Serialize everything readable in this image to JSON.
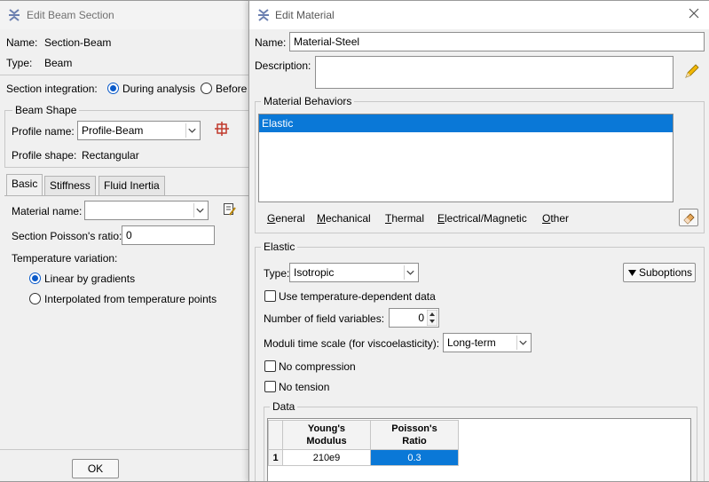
{
  "beam_dialog": {
    "title": "Edit Beam Section",
    "name_label": "Name:",
    "name_value": "Section-Beam",
    "type_label": "Type:",
    "type_value": "Beam",
    "section_integration_label": "Section integration:",
    "integration_options": [
      "During analysis",
      "Before"
    ],
    "beam_shape_title": "Beam Shape",
    "profile_name_label": "Profile name:",
    "profile_name_value": "Profile-Beam",
    "profile_shape_label": "Profile shape:",
    "profile_shape_value": "Rectangular",
    "tabs": [
      "Basic",
      "Stiffness",
      "Fluid Inertia"
    ],
    "material_name_label": "Material name:",
    "material_name_value": "",
    "poisson_label": "Section Poisson's ratio:",
    "poisson_value": "0",
    "temperature_label": "Temperature variation:",
    "temperature_options": [
      "Linear by gradients",
      "Interpolated from temperature points"
    ],
    "ok_label": "OK"
  },
  "material_dialog": {
    "title": "Edit Material",
    "name_label": "Name:",
    "name_value": "Material-Steel",
    "description_label": "Description:",
    "description_value": "",
    "behaviors_title": "Material Behaviors",
    "behaviors": [
      "Elastic"
    ],
    "menus": [
      "General",
      "Mechanical",
      "Thermal",
      "Electrical/Magnetic",
      "Other"
    ],
    "elastic_title": "Elastic",
    "type_label": "Type:",
    "type_value": "Isotropic",
    "suboptions_label": "Suboptions",
    "use_temp_label": "Use temperature-dependent data",
    "field_vars_label": "Number of field variables:",
    "field_vars_value": "0",
    "moduli_label": "Moduli time scale (for viscoelasticity):",
    "moduli_value": "Long-term",
    "no_compression_label": "No compression",
    "no_tension_label": "No tension",
    "data_title": "Data",
    "table": {
      "headers": [
        [
          "Young's",
          "Modulus"
        ],
        [
          "Poisson's",
          "Ratio"
        ]
      ],
      "rows": [
        {
          "index": "1",
          "cells": [
            "210e9",
            "0.3"
          ]
        }
      ]
    }
  },
  "colors": {
    "selection": "#0a78d7",
    "accent": "#0a5ac9"
  },
  "icons": [
    "app-icon",
    "close-icon",
    "profile-icon",
    "material-manager-icon",
    "edit-pencil-icon",
    "eraser-icon",
    "dropdown-arrow-icon"
  ]
}
